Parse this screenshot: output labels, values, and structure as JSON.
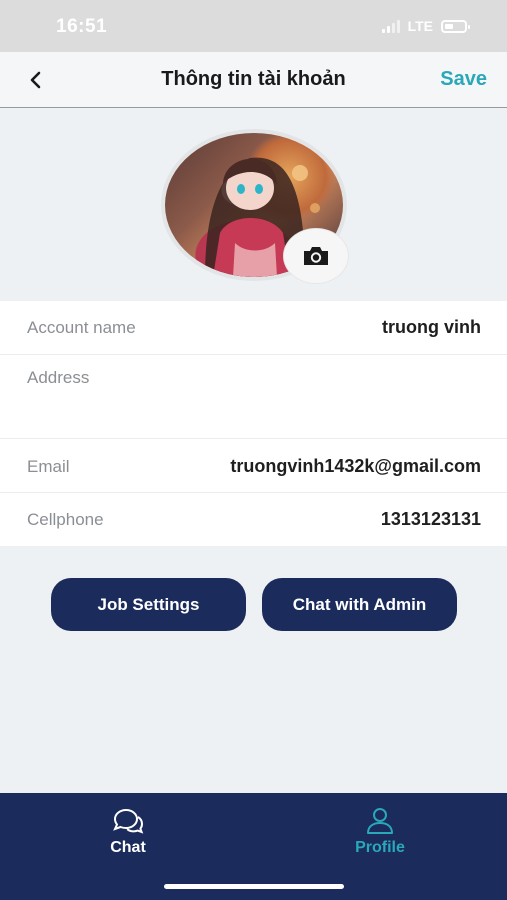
{
  "status_bar": {
    "time": "16:51",
    "network": "LTE"
  },
  "header": {
    "title": "Thông tin tài khoản",
    "save_label": "Save",
    "back_icon": "chevron-left-icon"
  },
  "avatar": {
    "camera_icon": "camera-icon"
  },
  "fields": [
    {
      "label": "Account name",
      "value": "truong vinh"
    },
    {
      "label": "Address",
      "value": ""
    },
    {
      "label": "Email",
      "value": "truongvinh1432k@gmail.com"
    },
    {
      "label": "Cellphone",
      "value": "1313123131"
    }
  ],
  "actions": {
    "job_settings": "Job Settings",
    "chat_admin": "Chat with Admin"
  },
  "tabs": [
    {
      "label": "Chat",
      "icon": "chat-bubbles-icon",
      "active": false
    },
    {
      "label": "Profile",
      "icon": "person-icon",
      "active": true
    }
  ],
  "colors": {
    "primary": "#1b2b5c",
    "accent": "#2aa7b8",
    "tab_inactive": "#ffffff",
    "tab_active": "#2aa7b8"
  }
}
